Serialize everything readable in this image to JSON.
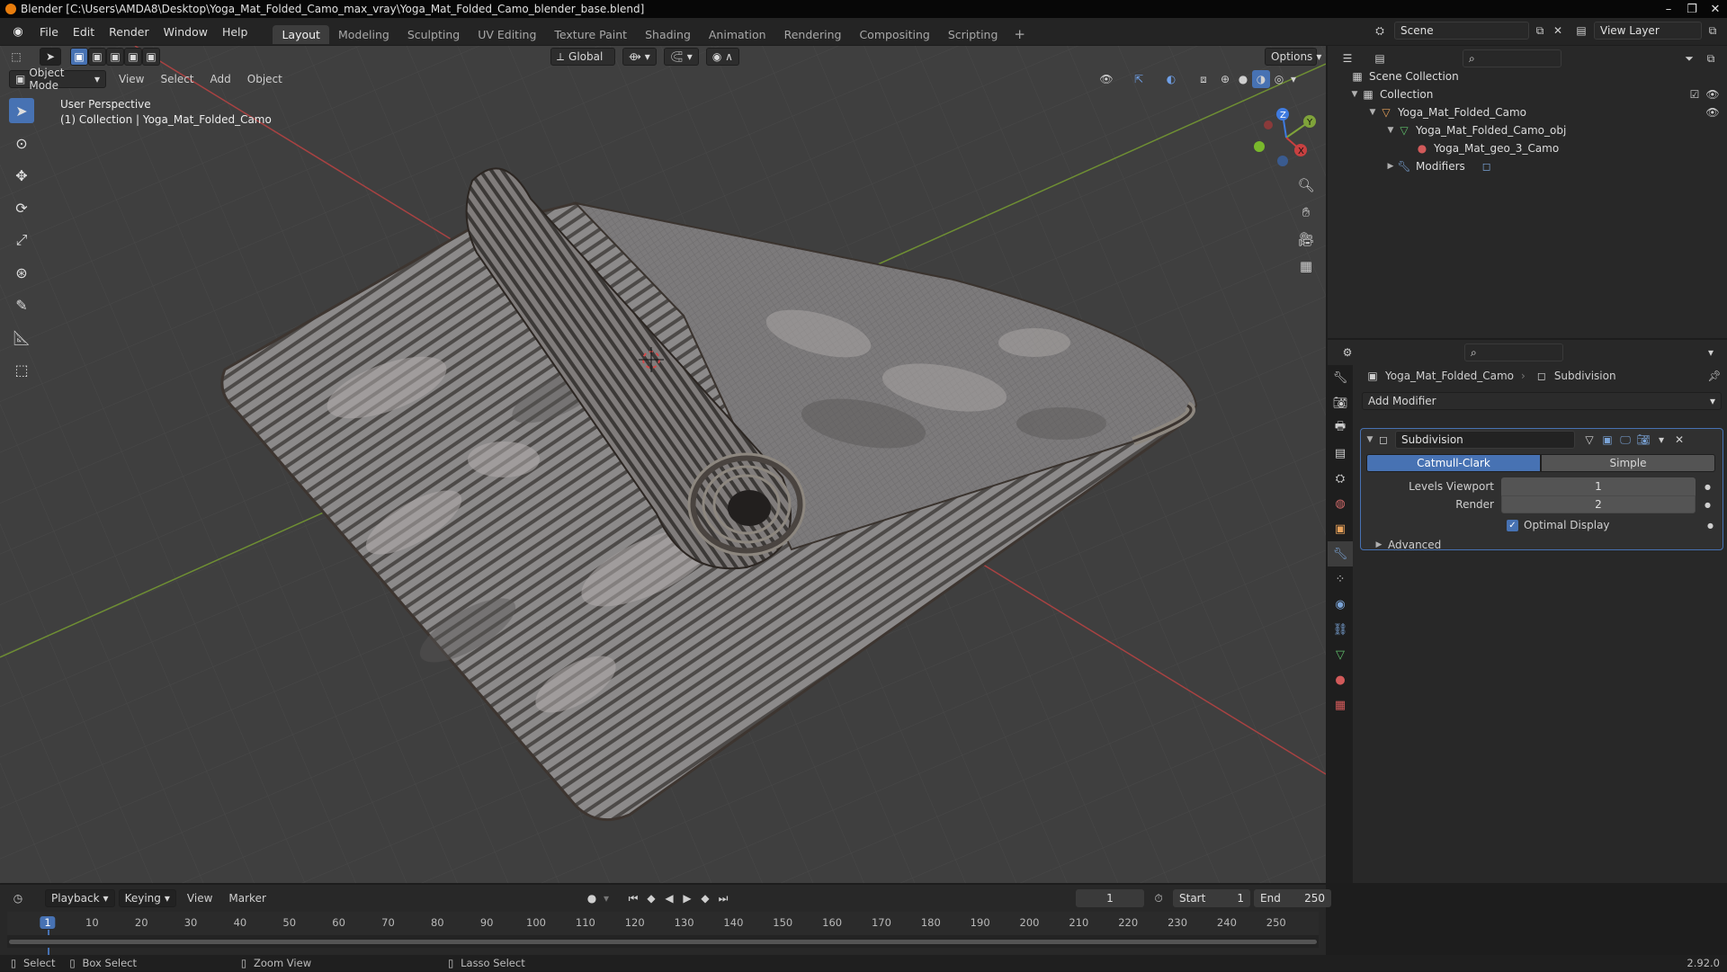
{
  "title_bar": {
    "title": "Blender [C:\\Users\\AMDA8\\Desktop\\Yoga_Mat_Folded_Camo_max_vray\\Yoga_Mat_Folded_Camo_blender_base.blend]"
  },
  "menu": {
    "items": [
      "File",
      "Edit",
      "Render",
      "Window",
      "Help"
    ]
  },
  "workspaces": [
    "Layout",
    "Modeling",
    "Sculpting",
    "UV Editing",
    "Texture Paint",
    "Shading",
    "Animation",
    "Rendering",
    "Compositing",
    "Scripting"
  ],
  "workspace_add": "+",
  "scene": {
    "name": "Scene",
    "view_layer": "View Layer"
  },
  "viewport": {
    "transform_orientation": "Global",
    "options_label": "Options",
    "mode": "Object Mode",
    "header_menus": [
      "View",
      "Select",
      "Add",
      "Object"
    ],
    "overlay_line1": "User Perspective",
    "overlay_line2": "(1) Collection | Yoga_Mat_Folded_Camo",
    "gizmo": {
      "x": "X",
      "y": "Y",
      "z": "Z"
    }
  },
  "outliner": {
    "root": "Scene Collection",
    "collection": "Collection",
    "object": "Yoga_Mat_Folded_Camo",
    "mesh": "Yoga_Mat_Folded_Camo_obj",
    "material": "Yoga_Mat_geo_3_Camo",
    "modifiers": "Modifiers"
  },
  "properties": {
    "object_name": "Yoga_Mat_Folded_Camo",
    "modifier_crumb": "Subdivision",
    "add_modifier": "Add Modifier",
    "modifier": {
      "name": "Subdivision",
      "type_a": "Catmull-Clark",
      "type_b": "Simple",
      "levels_viewport_label": "Levels Viewport",
      "levels_viewport": "1",
      "render_label": "Render",
      "render": "2",
      "optimal_display": "Optimal Display",
      "optimal_display_checked": true,
      "advanced": "Advanced"
    }
  },
  "timeline": {
    "menus": [
      "Playback",
      "Keying",
      "View",
      "Marker"
    ],
    "current_frame": "1",
    "start_label": "Start",
    "start": "1",
    "end_label": "End",
    "end": "250",
    "ruler": [
      "1",
      "10",
      "20",
      "30",
      "40",
      "50",
      "60",
      "70",
      "80",
      "90",
      "100",
      "110",
      "120",
      "130",
      "140",
      "150",
      "160",
      "170",
      "180",
      "190",
      "200",
      "210",
      "220",
      "230",
      "240",
      "250"
    ]
  },
  "status": {
    "select": "Select",
    "box_select": "Box Select",
    "zoom_view": "Zoom View",
    "lasso_select": "Lasso Select",
    "version": "2.92.0"
  },
  "colors": {
    "accent": "#4772b3",
    "viewport_bg": "#3f3f3f",
    "panel_bg": "#282828",
    "axis_x": "#c84040",
    "axis_y": "#7fa33a"
  }
}
